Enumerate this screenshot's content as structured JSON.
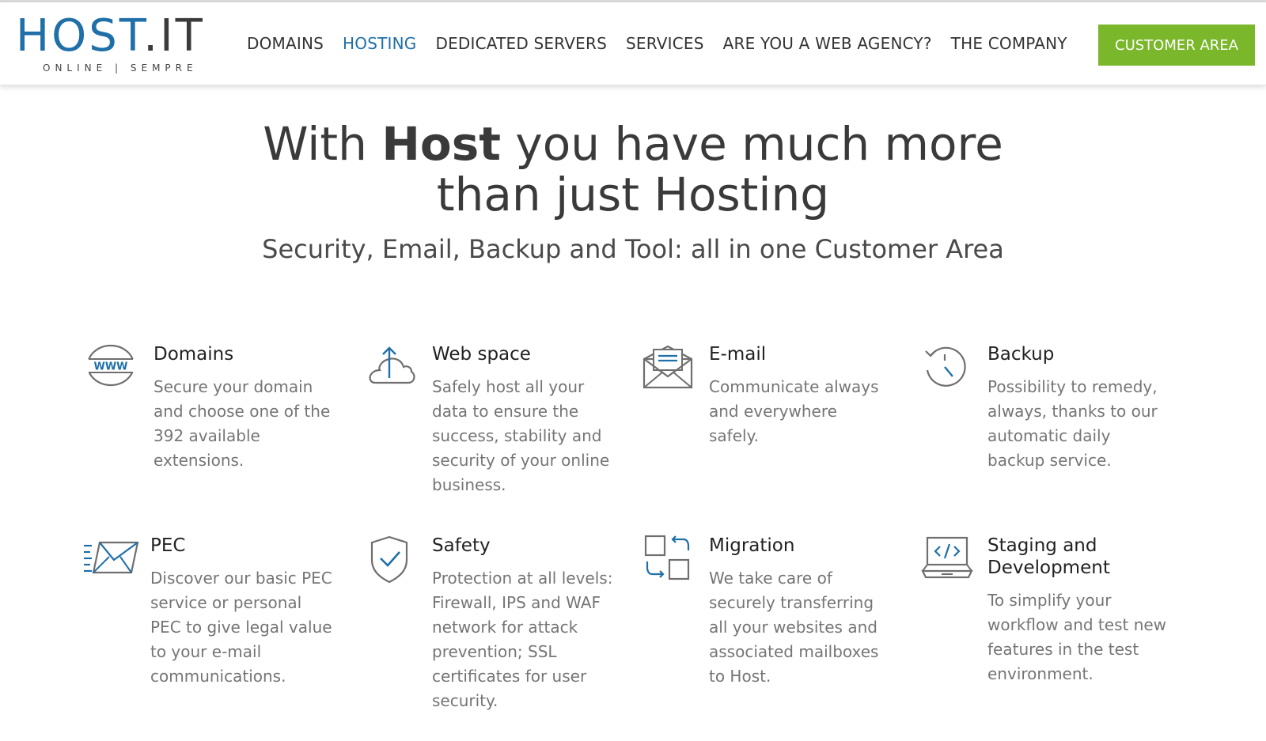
{
  "header": {
    "logo": {
      "host": "HOST",
      "dot_it": ".IT",
      "tagline": "ONLINE | SEMPRE"
    },
    "nav": [
      {
        "label": "DOMAINS"
      },
      {
        "label": "HOSTING"
      },
      {
        "label": "DEDICATED SERVERS"
      },
      {
        "label": "SERVICES"
      },
      {
        "label": "ARE YOU A WEB AGENCY?"
      },
      {
        "label": "THE COMPANY"
      }
    ],
    "active_nav": "HOSTING",
    "cta": "CUSTOMER AREA"
  },
  "hero": {
    "title_pre": "With ",
    "title_bold": "Host",
    "title_mid": " you have much more",
    "title_line2": "than just Hosting",
    "subtitle": "Security, Email, Backup and Tool: all in one Customer Area"
  },
  "features": [
    {
      "icon": "www-globe-icon",
      "title": "Domains",
      "desc": "Secure your domain and choose one of the 392 available extensions."
    },
    {
      "icon": "cloud-upload-icon",
      "title": "Web space",
      "desc": "Safely host all your data to ensure the success, stability and security of your online business."
    },
    {
      "icon": "envelope-open-icon",
      "title": "E-mail",
      "desc": "Communicate always and everywhere safely."
    },
    {
      "icon": "history-clock-icon",
      "title": "Backup",
      "desc": "Possibility to remedy, always, thanks to our automatic daily backup service."
    },
    {
      "icon": "fast-mail-icon",
      "title": "PEC",
      "desc": "Discover our basic PEC service or personal PEC to give legal value to your e-mail communications."
    },
    {
      "icon": "shield-check-icon",
      "title": "Safety",
      "desc": "Protection at all levels: Firewall, IPS and WAF network for attack prevention; SSL certificates for user security."
    },
    {
      "icon": "migration-icon",
      "title": "Migration",
      "desc": "We take care of securely transferring all your websites and associated mailboxes to Host."
    },
    {
      "icon": "laptop-code-icon",
      "title": "Staging and Development",
      "desc": "To simplify your workflow and test new features in the test environment."
    }
  ],
  "colors": {
    "brand_blue": "#1f6fa8",
    "accent_green": "#7ab72a",
    "text_dark": "#333333",
    "text_muted": "#757575",
    "icon_gray": "#6f6f6f"
  }
}
